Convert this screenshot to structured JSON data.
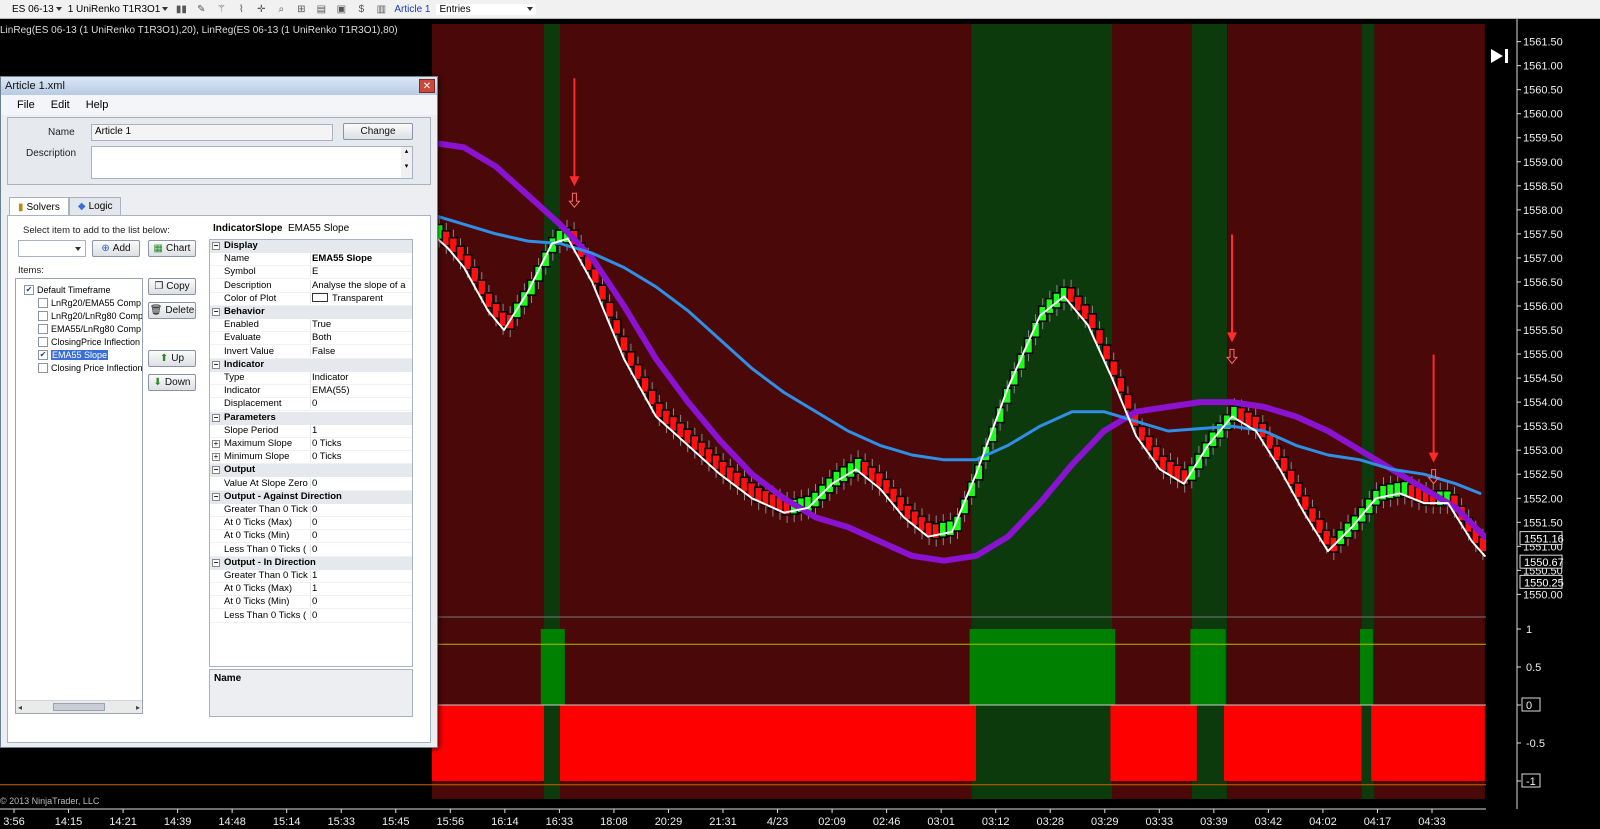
{
  "toolbar": {
    "instrument": "ES 06-13",
    "chart_type": "1 UniRenko T1R3O1",
    "article_link": "Article 1",
    "entries_select": "Entries"
  },
  "indicator_label": "LinReg(ES 06-13 (1 UniRenko T1R3O1),20), LinReg(ES 06-13 (1 UniRenko T1R3O1),80)",
  "copyright": "© 2013 NinjaTrader, LLC",
  "colors": {
    "bg": "#000000",
    "red_zone": "#4a0808",
    "green_zone": "#0c3a0c",
    "up_brick": "#19ff19",
    "down_brick": "#ff1010",
    "linreg20": "#ffffff",
    "linreg80": "#8a12d0",
    "ema55": "#2f8fe6",
    "panel_green": "#008000",
    "panel_red": "#ff0000",
    "arrow": "#ff2a2a"
  },
  "price_axis": {
    "ticks": [
      "1561.50",
      "1561.00",
      "1560.50",
      "1560.00",
      "1559.50",
      "1559.00",
      "1558.50",
      "1558.00",
      "1557.50",
      "1557.00",
      "1556.50",
      "1556.00",
      "1555.50",
      "1555.00",
      "1554.50",
      "1554.00",
      "1553.50",
      "1553.00",
      "1552.50",
      "1552.00",
      "1551.50",
      "1551.00",
      "1550.50",
      "1550.00"
    ],
    "markers": [
      "1551.16",
      "1550.67",
      "1550.25"
    ]
  },
  "panel_axis": {
    "ticks": [
      "1",
      "0.5",
      "0",
      "-0.5",
      "-1"
    ]
  },
  "time_axis": [
    "3:56",
    "14:15",
    "14:21",
    "14:39",
    "14:48",
    "15:14",
    "15:33",
    "15:45",
    "15:56",
    "16:14",
    "16:33",
    "18:08",
    "20:29",
    "21:31",
    "4/23",
    "02:09",
    "02:46",
    "03:01",
    "03:12",
    "03:28",
    "03:29",
    "03:33",
    "03:39",
    "03:42",
    "04:02",
    "04:17",
    "04:33"
  ],
  "window": {
    "title": "Article 1.xml",
    "menu": [
      "File",
      "Edit",
      "Help"
    ],
    "name_label": "Name",
    "name_value": "Article 1",
    "change_button": "Change",
    "description_label": "Description",
    "tabs": [
      "Solvers",
      "Logic"
    ],
    "select_hint": "Select item to add to the list below:",
    "add_button": "Add",
    "chart_button": "Chart",
    "items_label": "Items:",
    "copy_button": "Copy",
    "delete_button": "Delete",
    "up_button": "Up",
    "down_button": "Down",
    "tree": [
      {
        "label": "Default Timeframe",
        "checked": true,
        "level": 0
      },
      {
        "label": "LnRg20/EMA55 Comp",
        "checked": false,
        "level": 1
      },
      {
        "label": "LnRg20/LnRg80 Comp",
        "checked": false,
        "level": 1
      },
      {
        "label": "EMA55/LnRg80 Comp",
        "checked": false,
        "level": 1
      },
      {
        "label": "ClosingPrice Inflection",
        "checked": false,
        "level": 1
      },
      {
        "label": "EMA55 Slope",
        "checked": true,
        "level": 1,
        "selected": true
      },
      {
        "label": "Closing Price Inflection",
        "checked": false,
        "level": 1
      }
    ],
    "prop_header_type": "IndicatorSlope",
    "prop_header_name": "EMA55 Slope",
    "grid": [
      {
        "cat": "Display"
      },
      {
        "name": "Name",
        "value": "EMA55 Slope",
        "bold": true
      },
      {
        "name": "Symbol",
        "value": "E"
      },
      {
        "name": "Description",
        "value": "Analyse the slope of a"
      },
      {
        "name": "Color of Plot",
        "value": "Transparent",
        "swatch": true
      },
      {
        "cat": "Behavior"
      },
      {
        "name": "Enabled",
        "value": "True"
      },
      {
        "name": "Evaluate",
        "value": "Both"
      },
      {
        "name": "Invert Value",
        "value": "False"
      },
      {
        "cat": "Indicator"
      },
      {
        "name": "Type",
        "value": "Indicator"
      },
      {
        "name": "Indicator",
        "value": "EMA(55)"
      },
      {
        "name": "Displacement",
        "value": "0"
      },
      {
        "cat": "Parameters"
      },
      {
        "name": "Slope Period",
        "value": "1"
      },
      {
        "name": "Maximum Slope",
        "value": "0 Ticks",
        "expand": true
      },
      {
        "name": "Minimum Slope",
        "value": "0 Ticks",
        "expand": true
      },
      {
        "cat": "Output"
      },
      {
        "name": "Value At Slope Zero",
        "value": "0"
      },
      {
        "cat": "Output - Against Direction"
      },
      {
        "name": "Greater Than 0 Tick",
        "value": "0"
      },
      {
        "name": "At 0 Ticks (Max)",
        "value": "0"
      },
      {
        "name": "At 0 Ticks (Min)",
        "value": "0"
      },
      {
        "name": "Less Than 0 Ticks (",
        "value": "0"
      },
      {
        "cat": "Output - In Direction"
      },
      {
        "name": "Greater Than 0 Tick",
        "value": "1"
      },
      {
        "name": "At 0 Ticks (Max)",
        "value": "1"
      },
      {
        "name": "At 0 Ticks (Min)",
        "value": "0"
      },
      {
        "name": "Less Than 0 Ticks (",
        "value": "0"
      }
    ],
    "desc_title": "Name"
  },
  "zones": [
    {
      "color": "red",
      "from": 0.27,
      "to": 0.34
    },
    {
      "color": "green",
      "from": 0.34,
      "to": 0.35
    },
    {
      "color": "red",
      "from": 0.35,
      "to": 0.607
    },
    {
      "color": "green",
      "from": 0.607,
      "to": 0.695
    },
    {
      "color": "red",
      "from": 0.695,
      "to": 0.745
    },
    {
      "color": "green",
      "from": 0.745,
      "to": 0.767
    },
    {
      "color": "red",
      "from": 0.767,
      "to": 0.851
    },
    {
      "color": "green",
      "from": 0.851,
      "to": 0.859
    },
    {
      "color": "red",
      "from": 0.859,
      "to": 0.928
    }
  ],
  "panel_values": [
    {
      "from": 0.27,
      "to": 0.34,
      "value": -1
    },
    {
      "from": 0.338,
      "to": 0.353,
      "value": 1
    },
    {
      "from": 0.35,
      "to": 0.61,
      "value": -1
    },
    {
      "from": 0.606,
      "to": 0.697,
      "value": 1
    },
    {
      "from": 0.694,
      "to": 0.748,
      "value": -1
    },
    {
      "from": 0.744,
      "to": 0.766,
      "value": 1
    },
    {
      "from": 0.765,
      "to": 0.851,
      "value": -1
    },
    {
      "from": 0.85,
      "to": 0.858,
      "value": 1
    },
    {
      "from": 0.857,
      "to": 0.928,
      "value": -1
    }
  ],
  "chart_data": {
    "type": "line",
    "price_range": [
      1549.8,
      1561.7
    ],
    "linreg20": [
      [
        0.27,
        1557.5
      ],
      [
        0.28,
        1557.2
      ],
      [
        0.29,
        1556.8
      ],
      [
        0.305,
        1555.9
      ],
      [
        0.315,
        1555.5
      ],
      [
        0.33,
        1556.3
      ],
      [
        0.345,
        1557.3
      ],
      [
        0.355,
        1557.4
      ],
      [
        0.37,
        1556.5
      ],
      [
        0.39,
        1554.9
      ],
      [
        0.41,
        1553.7
      ],
      [
        0.43,
        1553.1
      ],
      [
        0.45,
        1552.5
      ],
      [
        0.47,
        1552.0
      ],
      [
        0.49,
        1551.7
      ],
      [
        0.505,
        1551.8
      ],
      [
        0.52,
        1552.3
      ],
      [
        0.535,
        1552.6
      ],
      [
        0.55,
        1552.2
      ],
      [
        0.565,
        1551.6
      ],
      [
        0.58,
        1551.2
      ],
      [
        0.595,
        1551.3
      ],
      [
        0.61,
        1552.5
      ],
      [
        0.63,
        1554.3
      ],
      [
        0.65,
        1555.8
      ],
      [
        0.665,
        1556.2
      ],
      [
        0.68,
        1555.6
      ],
      [
        0.695,
        1554.5
      ],
      [
        0.71,
        1553.3
      ],
      [
        0.725,
        1552.6
      ],
      [
        0.74,
        1552.3
      ],
      [
        0.755,
        1553.1
      ],
      [
        0.77,
        1553.7
      ],
      [
        0.785,
        1553.4
      ],
      [
        0.8,
        1552.6
      ],
      [
        0.815,
        1551.7
      ],
      [
        0.83,
        1550.9
      ],
      [
        0.845,
        1551.4
      ],
      [
        0.86,
        1552.0
      ],
      [
        0.875,
        1552.1
      ],
      [
        0.89,
        1551.9
      ],
      [
        0.905,
        1551.9
      ],
      [
        0.92,
        1551.1
      ],
      [
        0.928,
        1550.8
      ]
    ],
    "linreg80": [
      [
        0.27,
        1559.4
      ],
      [
        0.29,
        1559.3
      ],
      [
        0.31,
        1558.9
      ],
      [
        0.33,
        1558.3
      ],
      [
        0.35,
        1557.7
      ],
      [
        0.37,
        1557.0
      ],
      [
        0.39,
        1556.0
      ],
      [
        0.41,
        1554.9
      ],
      [
        0.43,
        1554.0
      ],
      [
        0.45,
        1553.2
      ],
      [
        0.47,
        1552.5
      ],
      [
        0.49,
        1552.0
      ],
      [
        0.51,
        1551.6
      ],
      [
        0.53,
        1551.4
      ],
      [
        0.55,
        1551.1
      ],
      [
        0.57,
        1550.8
      ],
      [
        0.59,
        1550.7
      ],
      [
        0.61,
        1550.8
      ],
      [
        0.63,
        1551.2
      ],
      [
        0.65,
        1551.9
      ],
      [
        0.67,
        1552.7
      ],
      [
        0.69,
        1553.4
      ],
      [
        0.71,
        1553.8
      ],
      [
        0.73,
        1553.9
      ],
      [
        0.75,
        1554.0
      ],
      [
        0.77,
        1554.0
      ],
      [
        0.79,
        1553.9
      ],
      [
        0.81,
        1553.7
      ],
      [
        0.83,
        1553.4
      ],
      [
        0.85,
        1553.0
      ],
      [
        0.87,
        1552.6
      ],
      [
        0.89,
        1552.2
      ],
      [
        0.91,
        1551.8
      ],
      [
        0.928,
        1551.2
      ]
    ],
    "ema55": [
      [
        0.27,
        1557.9
      ],
      [
        0.29,
        1557.7
      ],
      [
        0.31,
        1557.5
      ],
      [
        0.33,
        1557.35
      ],
      [
        0.35,
        1557.3
      ],
      [
        0.37,
        1557.1
      ],
      [
        0.39,
        1556.8
      ],
      [
        0.41,
        1556.4
      ],
      [
        0.43,
        1555.9
      ],
      [
        0.45,
        1555.3
      ],
      [
        0.47,
        1554.7
      ],
      [
        0.49,
        1554.2
      ],
      [
        0.51,
        1553.8
      ],
      [
        0.53,
        1553.4
      ],
      [
        0.55,
        1553.1
      ],
      [
        0.57,
        1552.9
      ],
      [
        0.59,
        1552.8
      ],
      [
        0.61,
        1552.8
      ],
      [
        0.63,
        1553.1
      ],
      [
        0.65,
        1553.5
      ],
      [
        0.67,
        1553.8
      ],
      [
        0.69,
        1553.8
      ],
      [
        0.71,
        1553.6
      ],
      [
        0.73,
        1553.4
      ],
      [
        0.75,
        1553.45
      ],
      [
        0.77,
        1553.5
      ],
      [
        0.79,
        1553.4
      ],
      [
        0.81,
        1553.1
      ],
      [
        0.83,
        1552.9
      ],
      [
        0.85,
        1552.8
      ],
      [
        0.87,
        1552.6
      ],
      [
        0.89,
        1552.5
      ],
      [
        0.91,
        1552.3
      ],
      [
        0.925,
        1552.1
      ]
    ],
    "arrows": [
      [
        0.359,
        1558.45
      ],
      [
        0.77,
        1555.2
      ],
      [
        0.896,
        1552.7
      ]
    ]
  }
}
